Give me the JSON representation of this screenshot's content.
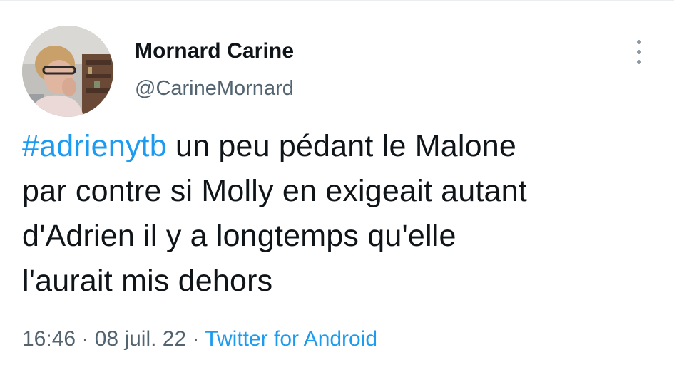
{
  "tweet": {
    "author": {
      "display_name": "Mornard Carine",
      "handle": "@CarineMornard",
      "avatar_icon": "user-photo-avatar"
    },
    "menu_icon": "more-vertical-icon",
    "text": {
      "hashtag": "#adrienytb",
      "body_parts": [
        " un peu pédant le Malone",
        "par contre si Molly en exigeait autant",
        "d'Adrien il y a longtemps qu'elle",
        "l'aurait mis dehors"
      ]
    },
    "meta": {
      "time": "16:46",
      "separator": " · ",
      "date": "08 juil. 22",
      "source": "Twitter for Android"
    }
  },
  "colors": {
    "link": "#1d9bf0",
    "secondary_text": "#536471",
    "primary_text": "#0f1419"
  }
}
